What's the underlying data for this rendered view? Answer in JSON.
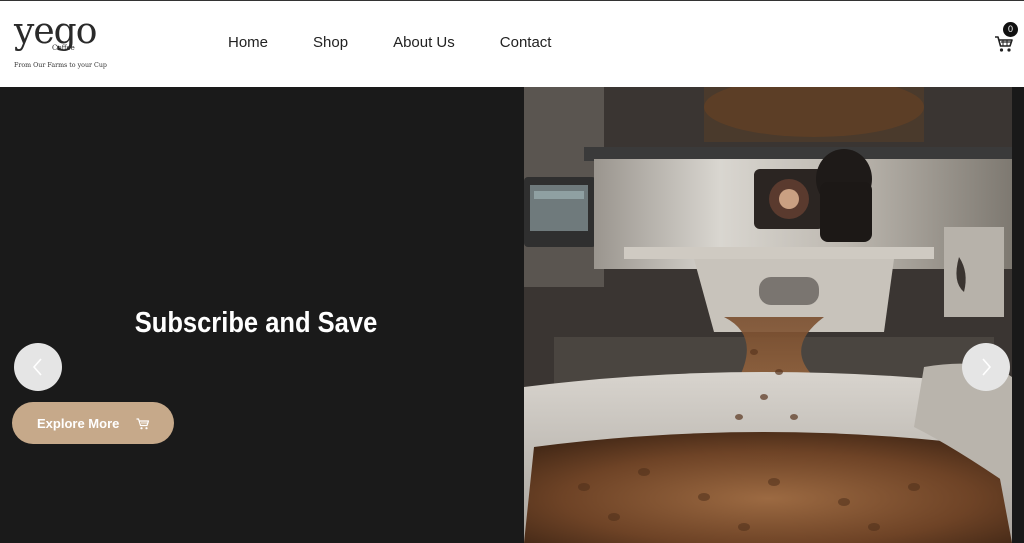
{
  "brand": {
    "logo_word": "yego",
    "logo_sub": "Coffee",
    "tagline": "From Our Farms to your Cup"
  },
  "nav": {
    "items": [
      {
        "label": "Home"
      },
      {
        "label": "Shop"
      },
      {
        "label": "About Us"
      },
      {
        "label": "Contact"
      }
    ]
  },
  "cart": {
    "count": "0",
    "icon": "cart-icon"
  },
  "hero": {
    "title": "Subscribe and Save",
    "cta_label": "Explore More",
    "cta_icon": "cart-icon",
    "prev_icon": "chevron-left-icon",
    "next_icon": "chevron-right-icon",
    "image": "coffee-roaster-photo"
  },
  "colors": {
    "accent": "#c6a98a",
    "hero_bg": "#1a1a1a",
    "header_bg": "#ffffff"
  }
}
